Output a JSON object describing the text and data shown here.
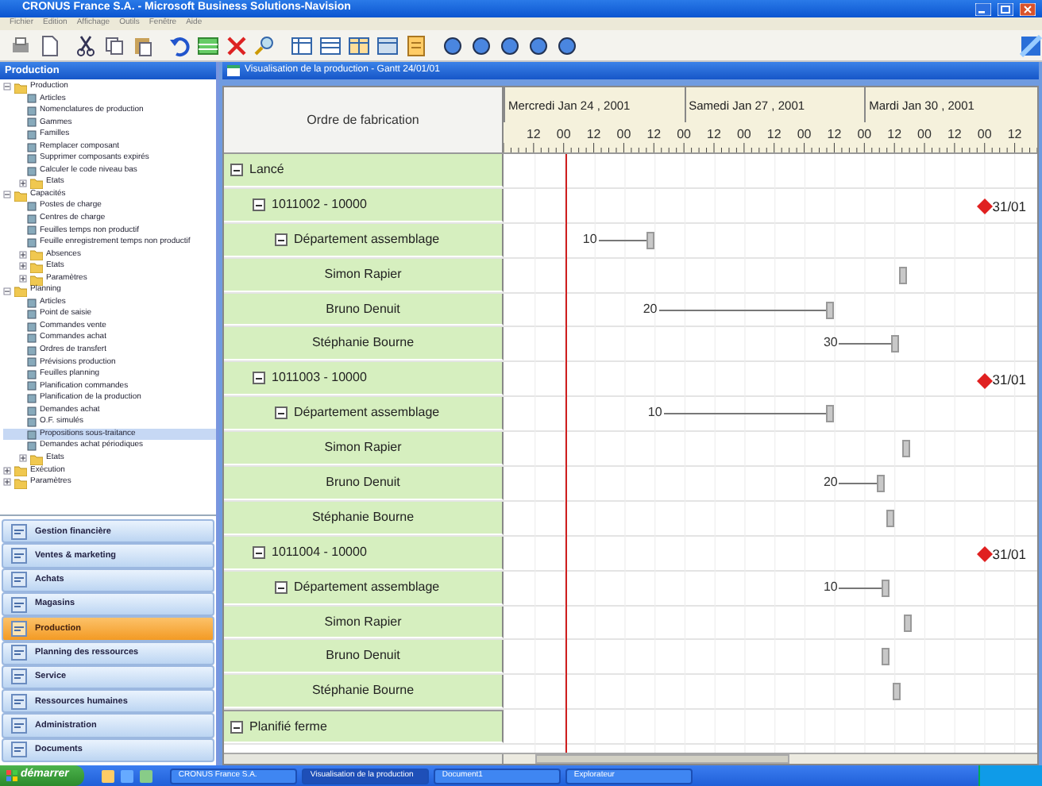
{
  "window": {
    "title": "CRONUS France S.A. - Microsoft Business Solutions-Navision"
  },
  "menu": [
    "Fichier",
    "Edition",
    "Affichage",
    "Outils",
    "Fenêtre",
    "Aide"
  ],
  "navigator": {
    "title": "Production",
    "tree": [
      {
        "label": "Production",
        "expanded": true,
        "selected": false,
        "children": [
          {
            "label": "Articles",
            "selected": false
          },
          {
            "label": "Nomenclatures de production",
            "selected": false
          },
          {
            "label": "Gammes",
            "selected": false
          },
          {
            "label": "Familles",
            "selected": false
          },
          {
            "label": "Remplacer composant",
            "selected": false
          },
          {
            "label": "Supprimer composants expirés",
            "selected": false
          },
          {
            "label": "Calculer le code niveau bas",
            "selected": false
          },
          {
            "label": "Etats",
            "expanded": false,
            "selected": false
          }
        ]
      },
      {
        "label": "Capacités",
        "expanded": true,
        "selected": false,
        "children": [
          {
            "label": "Postes de charge",
            "selected": false
          },
          {
            "label": "Centres de charge",
            "selected": false
          },
          {
            "label": "Feuilles temps non productif",
            "selected": false
          },
          {
            "label": "Feuille enregistrement temps non productif",
            "selected": false
          },
          {
            "label": "Absences",
            "expanded": false,
            "selected": false
          },
          {
            "label": "Etats",
            "expanded": false,
            "selected": false
          },
          {
            "label": "Paramètres",
            "expanded": false,
            "selected": false
          }
        ]
      },
      {
        "label": "Planning",
        "expanded": true,
        "selected": false,
        "children": [
          {
            "label": "Articles",
            "selected": false
          },
          {
            "label": "Point de saisie",
            "selected": false
          },
          {
            "label": "Commandes vente",
            "selected": false
          },
          {
            "label": "Commandes achat",
            "selected": false
          },
          {
            "label": "Ordres de transfert",
            "selected": false
          },
          {
            "label": "Prévisions production",
            "selected": false
          },
          {
            "label": "Feuilles planning",
            "selected": false
          },
          {
            "label": "Planification commandes",
            "selected": false
          },
          {
            "label": "Planification de la production",
            "selected": false
          },
          {
            "label": "Demandes achat",
            "selected": false
          },
          {
            "label": "O.F. simulés",
            "selected": false
          },
          {
            "label": "Propositions sous-traitance",
            "selected": true
          },
          {
            "label": "Demandes achat périodiques",
            "selected": false
          },
          {
            "label": "Etats",
            "expanded": false,
            "selected": false
          }
        ]
      },
      {
        "label": "Exécution",
        "expanded": false,
        "selected": false
      },
      {
        "label": "Paramètres",
        "expanded": false,
        "selected": false
      }
    ],
    "modules": [
      {
        "label": "Gestion financière",
        "selected": false
      },
      {
        "label": "Ventes & marketing",
        "selected": false
      },
      {
        "label": "Achats",
        "selected": false
      },
      {
        "label": "Magasins",
        "selected": false
      },
      {
        "label": "Production",
        "selected": true
      },
      {
        "label": "Planning des ressources",
        "selected": false
      },
      {
        "label": "Service",
        "selected": false
      },
      {
        "label": "Ressources humaines",
        "selected": false
      },
      {
        "label": "Administration",
        "selected": false
      },
      {
        "label": "Documents",
        "selected": false
      }
    ]
  },
  "gantt": {
    "title": "Visualisation de la production - Gantt 24/01/01",
    "column_header": "Ordre de fabrication",
    "days": [
      "Mercredi Jan 24 , 2001",
      "Samedi Jan 27 , 2001",
      "Mardi Jan 30 , 2001"
    ],
    "hours": [
      "12",
      "00",
      "12",
      "00",
      "12",
      "00",
      "12",
      "00",
      "12",
      "00",
      "12",
      "00",
      "12",
      "00",
      "12",
      "00",
      "12"
    ],
    "groups": [
      {
        "label": "Lancé",
        "expanded": true,
        "children": [
          {
            "label": "1011002 - 10000",
            "expanded": true,
            "milestone": {
              "label": "31/01"
            },
            "children": [
              {
                "label": "Département assemblage",
                "expanded": true,
                "bar_label": "10",
                "children": [
                  {
                    "label": "Simon Rapier"
                  },
                  {
                    "label": "Bruno Denuit",
                    "bar_label": "20"
                  },
                  {
                    "label": "Stéphanie Bourne",
                    "bar_label": "30"
                  }
                ]
              }
            ]
          },
          {
            "label": "1011003 - 10000",
            "expanded": true,
            "milestone": {
              "label": "31/01"
            },
            "children": [
              {
                "label": "Département assemblage",
                "expanded": true,
                "bar_label": "10",
                "children": [
                  {
                    "label": "Simon Rapier"
                  },
                  {
                    "label": "Bruno Denuit",
                    "bar_label": "20"
                  },
                  {
                    "label": "Stéphanie Bourne"
                  }
                ]
              }
            ]
          },
          {
            "label": "1011004 - 10000",
            "expanded": true,
            "milestone": {
              "label": "31/01"
            },
            "children": [
              {
                "label": "Département assemblage",
                "expanded": true,
                "bar_label": "10",
                "children": [
                  {
                    "label": "Simon Rapier"
                  },
                  {
                    "label": "Bruno Denuit"
                  },
                  {
                    "label": "Stéphanie Bourne"
                  }
                ]
              }
            ]
          }
        ]
      },
      {
        "label": "Planifié ferme",
        "expanded": true
      }
    ]
  },
  "taskbar": {
    "start": "démarrer",
    "tasks": [
      {
        "label": "CRONUS France S.A.",
        "selected": false
      },
      {
        "label": "Visualisation de la production",
        "selected": true
      },
      {
        "label": "Document1",
        "selected": false
      },
      {
        "label": "Explorateur",
        "selected": false
      }
    ]
  }
}
